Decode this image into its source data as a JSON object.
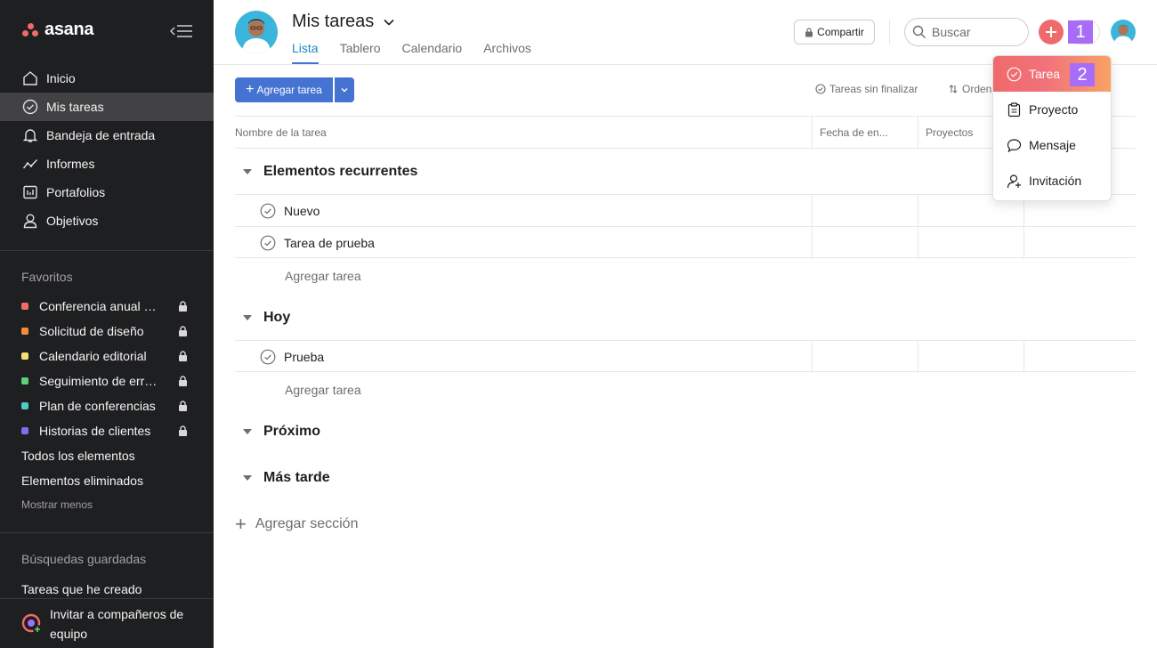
{
  "app": {
    "logo_text": "asana"
  },
  "sidebar": {
    "nav": [
      {
        "label": "Inicio",
        "icon": "home-icon"
      },
      {
        "label": "Mis tareas",
        "icon": "check-circle-icon",
        "active": true
      },
      {
        "label": "Bandeja de entrada",
        "icon": "bell-icon"
      },
      {
        "label": "Informes",
        "icon": "chart-line-icon"
      },
      {
        "label": "Portafolios",
        "icon": "portfolio-icon"
      },
      {
        "label": "Objetivos",
        "icon": "person-icon"
      }
    ],
    "favorites_title": "Favoritos",
    "favorites": [
      {
        "label": "Conferencia anual de ventas",
        "color": "#f06a6a"
      },
      {
        "label": "Solicitud de diseño",
        "color": "#f58b3b"
      },
      {
        "label": "Calendario editorial",
        "color": "#f8df72"
      },
      {
        "label": "Seguimiento de errores",
        "color": "#5ecf7a"
      },
      {
        "label": "Plan de conferencias",
        "color": "#4ecbc4"
      },
      {
        "label": "Historias de clientes",
        "color": "#7a6ff0"
      }
    ],
    "all_items": "Todos los elementos",
    "deleted_items": "Elementos eliminados",
    "show_less": "Mostrar menos",
    "saved_title": "Búsquedas guardadas",
    "saved_item": "Tareas que he creado",
    "invite_label": "Invitar a compañeros de equipo"
  },
  "header": {
    "title": "Mis tareas",
    "tabs": [
      "Lista",
      "Tablero",
      "Calendario",
      "Archivos"
    ],
    "share_label": "Compartir",
    "search_placeholder": "Buscar",
    "badge_1": "1"
  },
  "toolbar": {
    "add_task_label": "Agregar tarea",
    "filter_label": "Tareas sin finalizar",
    "sort_label": "Orden"
  },
  "table": {
    "columns": [
      "Nombre de la tarea",
      "Fecha de en...",
      "Proyectos"
    ],
    "sections": [
      {
        "title": "Elementos recurrentes",
        "tasks": [
          "Nuevo",
          "Tarea de prueba"
        ],
        "add_label": "Agregar tarea"
      },
      {
        "title": "Hoy",
        "tasks": [
          "Prueba"
        ],
        "add_label": "Agregar tarea"
      },
      {
        "title": "Próximo",
        "tasks": []
      },
      {
        "title": "Más tarde",
        "tasks": []
      }
    ],
    "add_section_label": "Agregar sección"
  },
  "menu": {
    "items": [
      {
        "label": "Tarea",
        "icon": "check-circle-icon"
      },
      {
        "label": "Proyecto",
        "icon": "clipboard-icon"
      },
      {
        "label": "Mensaje",
        "icon": "speech-bubble-icon"
      },
      {
        "label": "Invitación",
        "icon": "add-person-icon"
      }
    ],
    "badge_2": "2"
  }
}
